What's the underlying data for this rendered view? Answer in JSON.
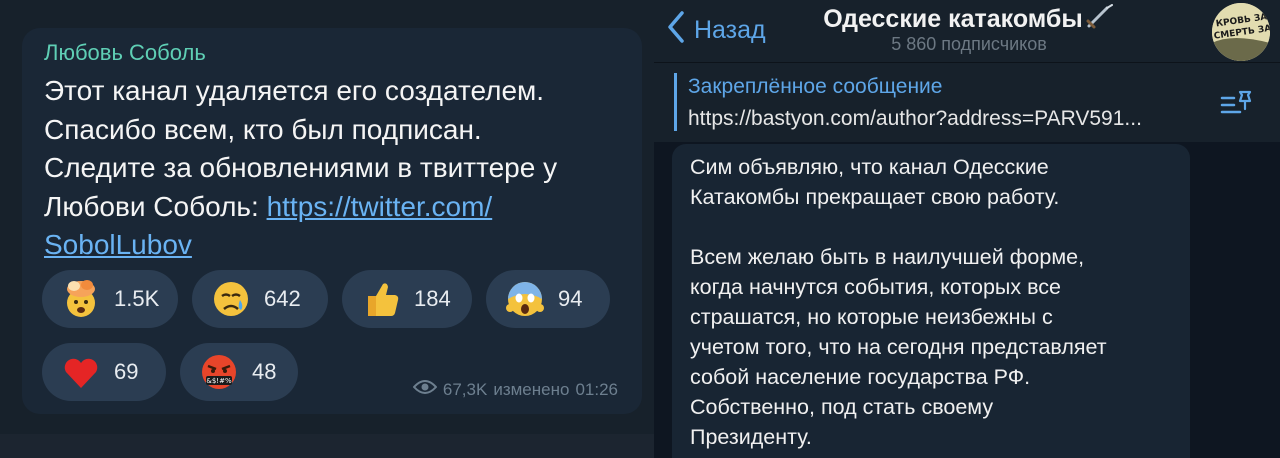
{
  "left": {
    "author": "Любовь Соболь",
    "text_lines": [
      "Этот канал удаляется его создателем.",
      "Спасибо всем, кто был подписан.",
      "Следите за обновлениями в твиттере у"
    ],
    "text_line4_prefix": "Любови Соболь: ",
    "link_part1": "https://twitter.com/",
    "link_part2": "SobolLubov",
    "reactions": [
      {
        "icon": "exploding-head-icon",
        "count": "1.5K"
      },
      {
        "icon": "crying-face-icon",
        "count": "642"
      },
      {
        "icon": "thumbs-up-icon",
        "count": "184"
      },
      {
        "icon": "screaming-face-icon",
        "count": "94"
      },
      {
        "icon": "red-heart-icon",
        "count": "69"
      },
      {
        "icon": "cursing-face-icon",
        "count": "48"
      }
    ],
    "views": "67,3K",
    "edited_label": "изменено",
    "time": "01:26"
  },
  "right": {
    "back_label": "Назад",
    "channel_title": "Одесские катакомбы",
    "title_emoji": "dagger-icon",
    "subscribers": "5 860 подписчиков",
    "avatar_text": "КРОВЬ ЗА КРО СМЕРТЬ ЗА СМЕ",
    "pinned_title": "Закреплённое сообщение",
    "pinned_text": "https://bastyon.com/author?address=PARV591...",
    "post_text": "Сим объявляю, что канал Одесские\nКатакомбы прекращает свою работу.\n\nВсем желаю быть в наилучшей форме,\nкогда начнутся события, которых все\nстрашатся, но которые неизбежны с\nучетом того, что на сегодня представляет\nсобой население государства РФ.\nСобственно, под стать своему\nПрезиденту."
  },
  "colors": {
    "accent": "#5ea6e8",
    "author": "#5fcfb5",
    "link": "#6ab3f3",
    "bubble": "#1a2736",
    "reaction_bg": "#2b3d52"
  }
}
